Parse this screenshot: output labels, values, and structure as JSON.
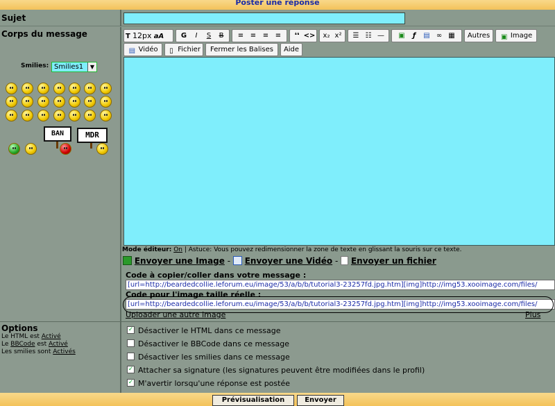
{
  "header": {
    "title": "Poster une réponse"
  },
  "form": {
    "sujet_label": "Sujet",
    "corps_label": "Corps du message",
    "smilies_label": "Smilies:",
    "smilies_selected": "Smilies1",
    "ban_text": "BAN",
    "mdr_text": "MDR"
  },
  "toolbar": {
    "size_label": "12px",
    "aa_label": "aA",
    "bold": "G",
    "italic": "I",
    "underline": "S",
    "strike": "B",
    "quote": "❛❛",
    "code": "<>",
    "sub": "x₂",
    "sup": "x²",
    "autres": "Autres",
    "image": "Image",
    "video": "Vidéo",
    "fichier": "Fichier",
    "fermer": "Fermer les Balises",
    "aide": "Aide"
  },
  "editor_info": {
    "mode_label": "Mode éditeur:",
    "mode_value": "On",
    "tip": " | Astuce: Vous pouvez redimensionner la zone de texte en glissant la souris sur ce texte."
  },
  "upload": {
    "send_image": "Envoyer une Image",
    "send_video": "Envoyer une Vidéo",
    "send_file": "Envoyer un fichier",
    "sep": "-",
    "code_copy_title": "Code à copier/coller dans votre message :",
    "code_copy_value": "[url=http://beardedcollie.leforum.eu/image/53/a/b/b/tutorial3-23257fd.jpg.htm][img]http://img53.xooimage.com/files/",
    "code_full_title": "Code pour l'image taille réelle :",
    "code_full_value": "[url=http://beardedcollie.leforum.eu/image/53/a/b/b/tutorial3-23257fd.jpg.htm][img]http://img53.xooimage.com/files/",
    "upload_another": "Uploader une autre image",
    "plus": "Plus >>"
  },
  "options": {
    "title": "Options",
    "html_status_prefix": "Le HTML est ",
    "html_status": "Activé",
    "bbcode_status_prefix_1": "Le ",
    "bbcode_link": "BBCode",
    "bbcode_status_prefix_2": " est ",
    "bbcode_status": "Activé",
    "smilies_status_prefix": "Les smilies sont ",
    "smilies_status": "Activés",
    "items": [
      {
        "label": "Désactiver le HTML dans ce message",
        "checked": true
      },
      {
        "label": "Désactiver le BBCode dans ce message",
        "checked": false
      },
      {
        "label": "Désactiver les smilies dans ce message",
        "checked": false
      },
      {
        "label": "Attacher sa signature (les signatures peuvent être modifiées dans le profil)",
        "checked": true
      },
      {
        "label": "M'avertir lorsqu'une réponse est postée",
        "checked": true
      }
    ]
  },
  "buttons": {
    "preview": "Prévisualisation",
    "send": "Envoyer"
  }
}
